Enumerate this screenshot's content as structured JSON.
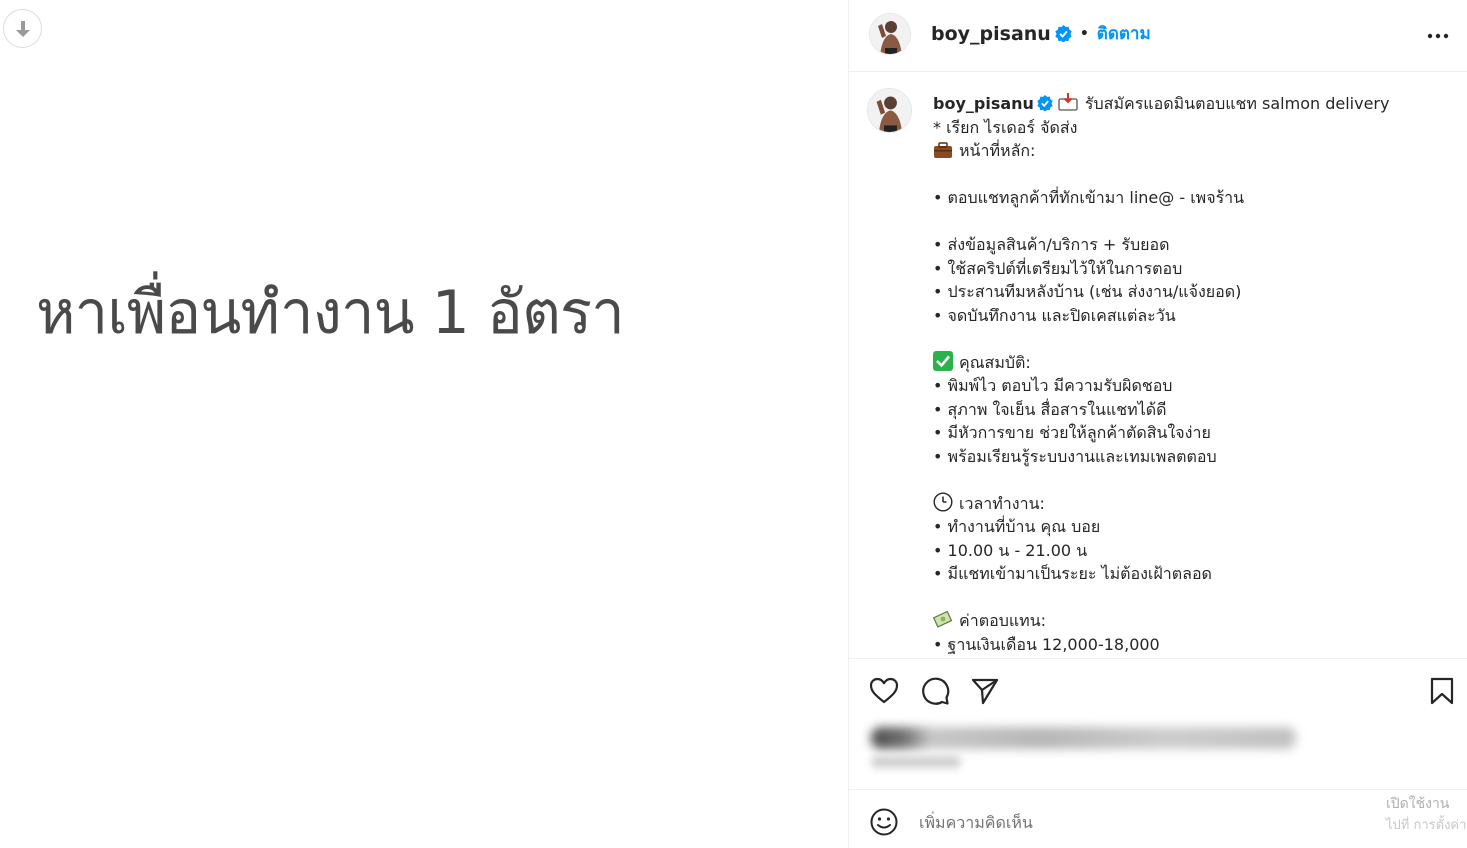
{
  "media": {
    "title": "หาเพื่อนทำงาน 1 อัตรา",
    "download_icon": "download-arrow-icon"
  },
  "header": {
    "username": "boy_pisanu",
    "separator": "•",
    "follow_label": "ติดตาม",
    "more_icon": "more-horizontal-icon"
  },
  "caption": {
    "username": "boy_pisanu",
    "lines": [
      {
        "emoji": "",
        "text": "รับสมัครแอดมินตอบแชท salmon delivery"
      },
      {
        "emoji": "",
        "text": "* เรียก ไรเดอร์ จัดส่ง"
      },
      {
        "emoji": "briefcase",
        "text": "หน้าที่หลัก:"
      },
      {
        "emoji": "",
        "text": ""
      },
      {
        "emoji": "",
        "text": "• ตอบแชทลูกค้าที่ทักเข้ามา line@ - เพจร้าน"
      },
      {
        "emoji": "",
        "text": ""
      },
      {
        "emoji": "",
        "text": "• ส่งข้อมูลสินค้า/บริการ + รับยอด"
      },
      {
        "emoji": "",
        "text": "• ใช้สคริปต์ที่เตรียมไว้ให้ในการตอบ"
      },
      {
        "emoji": "",
        "text": "• ประสานทีมหลังบ้าน (เช่น ส่งงาน/แจ้งยอด)"
      },
      {
        "emoji": "",
        "text": "• จดบันทึกงาน และปิดเคสแต่ละวัน"
      },
      {
        "emoji": "",
        "text": ""
      },
      {
        "emoji": "check",
        "text": "คุณสมบัติ:"
      },
      {
        "emoji": "",
        "text": "• พิมพ์ไว ตอบไว มีความรับผิดชอบ"
      },
      {
        "emoji": "",
        "text": "• สุภาพ ใจเย็น สื่อสารในแชทได้ดี"
      },
      {
        "emoji": "",
        "text": "• มีหัวการขาย ช่วยให้ลูกค้าตัดสินใจง่าย"
      },
      {
        "emoji": "",
        "text": "• พร้อมเรียนรู้ระบบงานและเทมเพลตตอบ"
      },
      {
        "emoji": "",
        "text": ""
      },
      {
        "emoji": "clock",
        "text": "เวลาทำงาน:"
      },
      {
        "emoji": "",
        "text": "• ทำงานที่บ้าน คุณ บอย"
      },
      {
        "emoji": "",
        "text": "• 10.00 น - 21.00 น"
      },
      {
        "emoji": "",
        "text": "• มีแชทเข้ามาเป็นระยะ ไม่ต้องเฝ้าตลอด"
      },
      {
        "emoji": "",
        "text": ""
      },
      {
        "emoji": "money",
        "text": "ค่าตอบแทน:"
      },
      {
        "emoji": "",
        "text": "• ฐานเงินเดือน 12,000-18,000"
      }
    ]
  },
  "actions": {
    "like_icon": "heart-icon",
    "comment_icon": "comment-icon",
    "share_icon": "send-icon",
    "save_icon": "bookmark-icon"
  },
  "comment": {
    "placeholder": "เพิ่มความคิดเห็น",
    "emoji_icon": "smile-icon"
  },
  "watermark": {
    "line1": "เปิดใช้งาน ",
    "line2": "ไปที่ การตั้งค่า"
  },
  "colors": {
    "accent": "#0095f6",
    "verified": "#0095f6",
    "border": "#efefef",
    "media_text": "#4a4a4a"
  }
}
